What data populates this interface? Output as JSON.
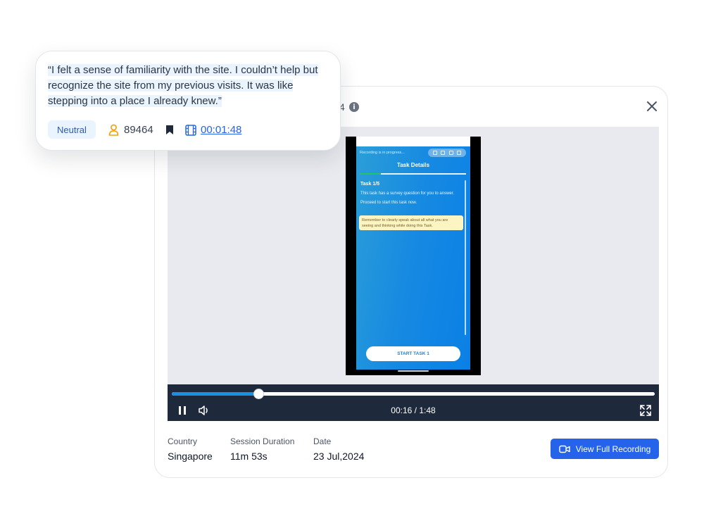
{
  "quote": {
    "text": "“I felt a sense of familiarity with the site. I couldn’t help but recognize the site from my previous visits. It was like stepping into a place I already knew.”",
    "sentiment": "Neutral",
    "user_id": "89464",
    "timestamp": "00:01:48"
  },
  "header": {
    "title_fragment": "4"
  },
  "phone": {
    "recording_text": "Recording is in progress...",
    "title": "Task Details",
    "task_number": "Task 1/5",
    "task_description": "This task has a survey question for you to answer. Proceed to start this task now.",
    "note": "Remember to clearly speak about all what you are seeing and thinking while doing this Task.",
    "start_button": "START TASK 1"
  },
  "player": {
    "time_display": "00:16 / 1:48",
    "progress": 0.18
  },
  "meta": {
    "country_label": "Country",
    "country_value": "Singapore",
    "duration_label": "Session Duration",
    "duration_value": "11m 53s",
    "date_label": "Date",
    "date_value": "23 Jul,2024"
  },
  "actions": {
    "view_full_recording": "View Full Recording"
  },
  "colors": {
    "accent": "#2563eb",
    "player_bg": "#1e293b",
    "progress": "#1b8fe0"
  }
}
